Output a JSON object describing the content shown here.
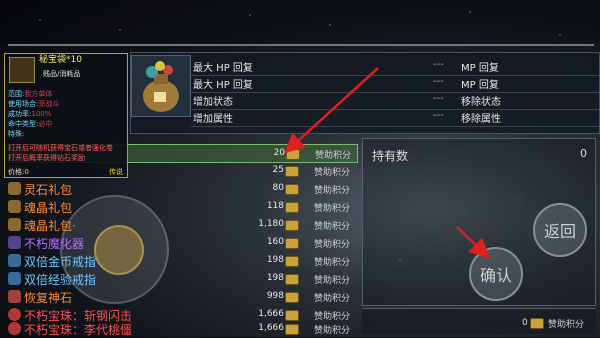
{
  "info_panel": {
    "rows": [
      {
        "left": "最大 HP 回复",
        "dash": "---",
        "right": "MP 回复"
      },
      {
        "left": "最大 HP 回复",
        "dash": "---",
        "right": "MP 回复"
      },
      {
        "left": "增加状态",
        "dash": "---",
        "right": "移除状态"
      },
      {
        "left": "增加属性",
        "dash": "---",
        "right": "移除属性"
      }
    ]
  },
  "tooltip": {
    "title": "秘宝袋*10",
    "subtype": "贱品/消耗品",
    "lines": [
      {
        "label": "范围:",
        "value": "我方单体"
      },
      {
        "label": "使用场合:",
        "value": "菲战斗"
      },
      {
        "label": "成功率:",
        "value": "100%"
      },
      {
        "label": "命中类型:",
        "value": "必中"
      },
      {
        "label": "特殊:",
        "value": ""
      }
    ],
    "desc": "打开后可随机获得宝石或者强化卷",
    "hint": "打开后概率获得钻石奖励",
    "price_label": "价格:",
    "price_value": "0",
    "legend": "传说"
  },
  "items": [
    {
      "name": "",
      "price": "20",
      "currency": "赞助积分",
      "color": "#ffffff",
      "icon": "#c9a23a"
    },
    {
      "name": "",
      "price": "25",
      "currency": "赞助积分",
      "color": "#ffffff",
      "icon": "#7a5a2a"
    },
    {
      "name": "灵石礼包",
      "price": "80",
      "currency": "赞助积分",
      "color": "#ff8a3a",
      "icon": "#8a6a30"
    },
    {
      "name": "魂晶礼包",
      "price": "118",
      "currency": "赞助积分",
      "color": "#ff8a3a",
      "icon": "#8a6a30"
    },
    {
      "name": "魂晶礼包·",
      "price": "1,180",
      "currency": "赞助积分",
      "color": "#ff8a3a",
      "icon": "#8a6a30"
    },
    {
      "name": "不朽魔化器",
      "price": "160",
      "currency": "赞助积分",
      "color": "#b070ff",
      "icon": "#554488"
    },
    {
      "name": "双倍金币戒指",
      "price": "198",
      "currency": "赞助积分",
      "color": "#6fc8ff",
      "icon": "#3a6a9a"
    },
    {
      "name": "双倍经验戒指",
      "price": "198",
      "currency": "赞助积分",
      "color": "#6fc8ff",
      "icon": "#3a6a9a"
    },
    {
      "name": "恢复神石",
      "price": "998",
      "currency": "赞助积分",
      "color": "#ff8a3a",
      "icon": "#a04040"
    },
    {
      "name": "不朽宝珠：斩钢闪击",
      "price": "1,666",
      "currency": "赞助积分",
      "color": "#ff5050",
      "icon": "#b03a3a"
    },
    {
      "name": "不朽宝珠：李代桃僵",
      "price": "1,666",
      "currency": "赞助积分",
      "color": "#ff5050",
      "icon": "#b03a3a"
    }
  ],
  "holdings": {
    "label": "持有数",
    "value": "0"
  },
  "buttons": {
    "back": "返回",
    "confirm": "确认"
  },
  "footer": {
    "value": "0",
    "currency": "赞助积分"
  },
  "colors": {
    "accent_arrow": "#e02020",
    "tooltip_border": "#b0a040"
  }
}
